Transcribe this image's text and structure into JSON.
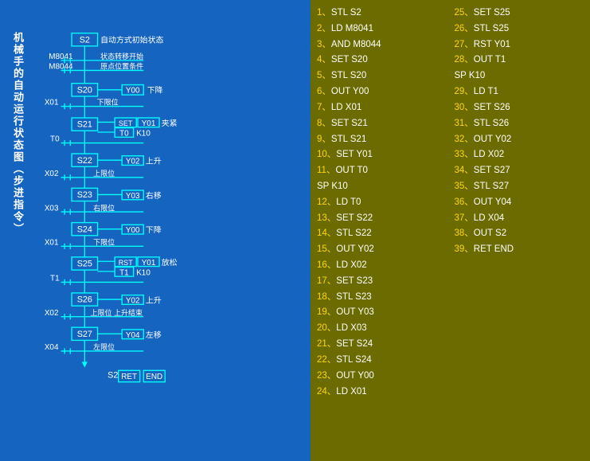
{
  "leftPanel": {
    "title": "机械手的自动运行状态图（步进指令）",
    "ladderElements": {
      "startState": "S2",
      "autoModeLabel": "自动方式初始状态",
      "stateTransLabel": "状态转移开始",
      "originLabel": "原点位置条件",
      "inputs": [
        "M8041",
        "M8044",
        "X01",
        "X02",
        "X03",
        "X01",
        "T1",
        "X02",
        "X04"
      ],
      "states": [
        "S2",
        "S20",
        "S21",
        "S22",
        "S23",
        "S24",
        "S25",
        "S26",
        "S27"
      ],
      "outputs": [
        "Y00",
        "Y01",
        "Y02",
        "Y03",
        "Y00",
        "Y01",
        "Y02",
        "Y04"
      ],
      "actions": [
        "下降",
        "夹紧",
        "上升",
        "右移",
        "下降",
        "放松",
        "上升",
        "左移"
      ],
      "bottomLabels": [
        "S2",
        "RET",
        "END"
      ]
    }
  },
  "rightPanel": {
    "col1": [
      {
        "num": "1、",
        "instr": "STL S2"
      },
      {
        "num": "2、",
        "instr": "LD  M8041"
      },
      {
        "num": "3、",
        "instr": "AND M8044"
      },
      {
        "num": "4、",
        "instr": "SET S20"
      },
      {
        "num": "5、",
        "instr": "STL S20"
      },
      {
        "num": "6、",
        "instr": "OUT Y00"
      },
      {
        "num": "7、",
        "instr": "LD  X01"
      },
      {
        "num": "8、",
        "instr": "SET S21"
      },
      {
        "num": "9、",
        "instr": "STL S21"
      },
      {
        "num": "10、",
        "instr": "SET Y01"
      },
      {
        "num": "11、",
        "instr": "OUT T0"
      },
      {
        "num": "",
        "instr": "SP K10"
      },
      {
        "num": "12、",
        "instr": "LD  T0"
      },
      {
        "num": "13、",
        "instr": "SET S22"
      },
      {
        "num": "14、",
        "instr": "STL S22"
      },
      {
        "num": "15、",
        "instr": "OUT Y02"
      },
      {
        "num": "16、",
        "instr": "LD  X02"
      },
      {
        "num": "17、",
        "instr": "SET S23"
      },
      {
        "num": "18、",
        "instr": "STL S23"
      },
      {
        "num": "19、",
        "instr": "OUT Y03"
      },
      {
        "num": "20、",
        "instr": "LD  X03"
      },
      {
        "num": "21、",
        "instr": "SET S24"
      },
      {
        "num": "22、",
        "instr": "STL S24"
      },
      {
        "num": "23、",
        "instr": "OUT Y00"
      },
      {
        "num": "24、",
        "instr": "LD  X01"
      }
    ],
    "col2": [
      {
        "num": "25、",
        "instr": "SET S25"
      },
      {
        "num": "26、",
        "instr": "STL S25"
      },
      {
        "num": "27、",
        "instr": "RST Y01"
      },
      {
        "num": "28、",
        "instr": "OUT T1"
      },
      {
        "num": "",
        "instr": "SP K10"
      },
      {
        "num": "29、",
        "instr": "LD  T1"
      },
      {
        "num": "30、",
        "instr": "SET S26"
      },
      {
        "num": "31、",
        "instr": "STL S26"
      },
      {
        "num": "32、",
        "instr": "OUT Y02"
      },
      {
        "num": "33、",
        "instr": "LD  X02"
      },
      {
        "num": "34、",
        "instr": "SET S27"
      },
      {
        "num": "35、",
        "instr": "STL S27"
      },
      {
        "num": "36、",
        "instr": "OUT Y04"
      },
      {
        "num": "37、",
        "instr": "LD  X04"
      },
      {
        "num": "38、",
        "instr": "OUT S2"
      },
      {
        "num": "39、",
        "instr": "RET END"
      }
    ]
  },
  "colors": {
    "leftBg": "#1460B0",
    "rightBg": "#6B6B00",
    "lineColor": "#00FFFF",
    "boxColor": "#00FFFF",
    "textColor": "#FFFFFF",
    "labelColor": "#00FFFF",
    "inputColor": "#FFFFFF",
    "yellowText": "#FFD700"
  }
}
